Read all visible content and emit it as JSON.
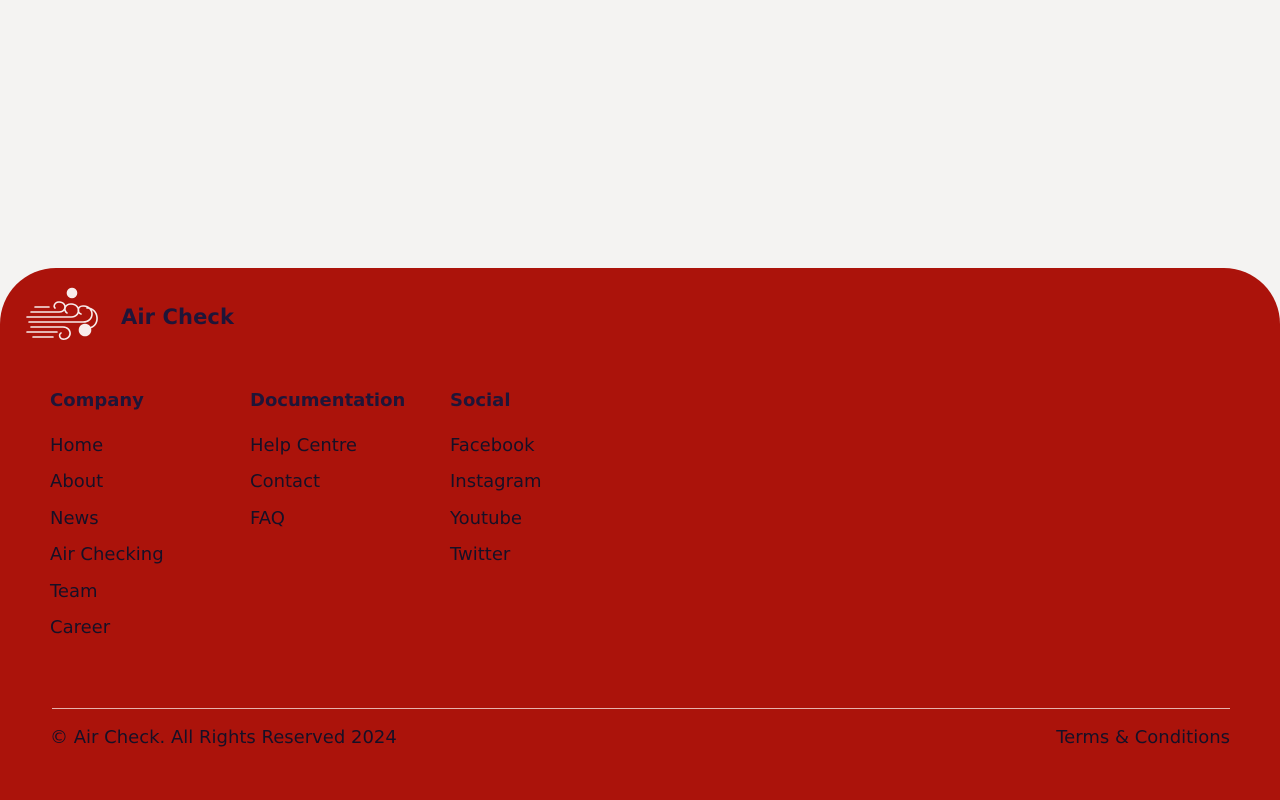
{
  "brand": {
    "name": "Air Check",
    "logo_icon": "wind-icon"
  },
  "footer": {
    "columns": [
      {
        "title": "Company",
        "links": [
          "Home",
          "About",
          "News",
          "Air Checking",
          "Team",
          "Career"
        ]
      },
      {
        "title": "Documentation",
        "links": [
          "Help Centre",
          "Contact",
          "FAQ"
        ]
      },
      {
        "title": "Social",
        "links": [
          "Facebook",
          "Instagram",
          "Youtube",
          "Twitter"
        ]
      }
    ],
    "copyright": "© Air Check. All Rights Reserved 2024",
    "terms": "Terms & Conditions"
  },
  "colors": {
    "page_background": "#f4f3f2",
    "footer_background": "#ab130b",
    "text": "#161026",
    "heading": "#1f1538"
  }
}
